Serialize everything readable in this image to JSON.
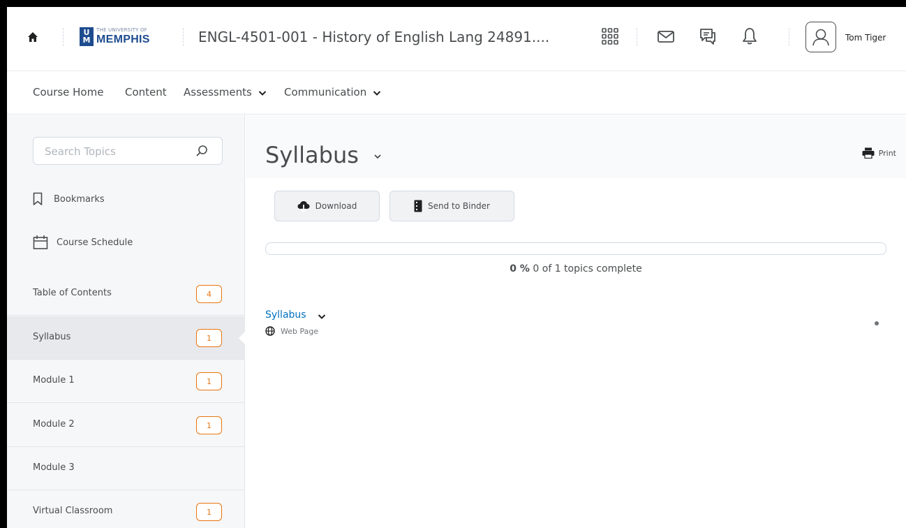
{
  "header": {
    "logo_small": "THE UNIVERSITY OF",
    "logo_big": "MEMPHIS",
    "logo_mark": "U M",
    "course_title": "ENGL-4501-001 - History of English Lang 24891....",
    "user_name": "Tom Tiger",
    "icons": [
      "home-icon",
      "waffle-icon",
      "mail-icon",
      "chat-icon",
      "bell-icon",
      "avatar-icon"
    ]
  },
  "nav": {
    "items": [
      {
        "label": "Course Home",
        "dropdown": false
      },
      {
        "label": "Content",
        "dropdown": false
      },
      {
        "label": "Assessments",
        "dropdown": true
      },
      {
        "label": "Communication",
        "dropdown": true
      }
    ]
  },
  "sidebar": {
    "search_placeholder": "Search Topics",
    "bookmarks_label": "Bookmarks",
    "schedule_label": "Course Schedule",
    "toc": [
      {
        "label": "Table of Contents",
        "badge": "4",
        "selected": false
      },
      {
        "label": "Syllabus",
        "badge": "1",
        "selected": true
      },
      {
        "label": "Module 1",
        "badge": "1",
        "selected": false
      },
      {
        "label": "Module 2",
        "badge": "1",
        "selected": false
      },
      {
        "label": "Module 3",
        "badge": "",
        "selected": false
      },
      {
        "label": "Virtual Classroom",
        "badge": "1",
        "selected": false
      }
    ]
  },
  "main": {
    "title": "Syllabus",
    "print_label": "Print",
    "download_label": "Download",
    "binder_label": "Send to Binder",
    "progress_fraction": 0,
    "progress_percent": "0 %",
    "progress_summary": "0 of 1 topics complete",
    "topic_title": "Syllabus",
    "topic_type": "Web Page"
  },
  "colors": {
    "accent": "#e87511",
    "link": "#006fbf",
    "brand": "#1d4b8f"
  }
}
